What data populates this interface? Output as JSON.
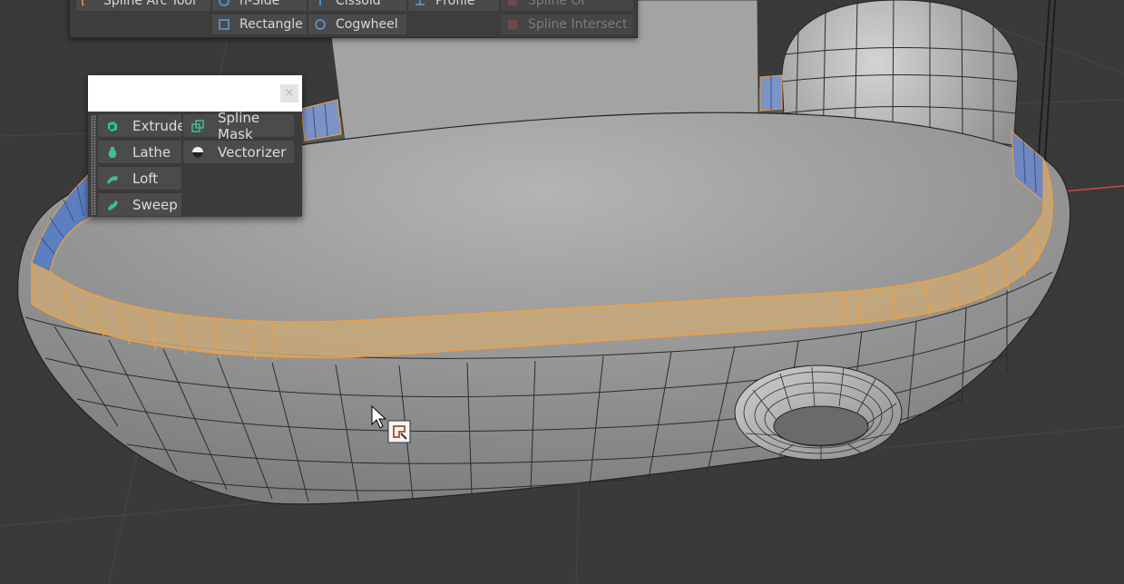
{
  "colors": {
    "background": "#3a3a3a",
    "selection_edge": "#f0a040",
    "selection_fill": "#c9a878",
    "menu_bg": "#3d3d3d",
    "item_bg": "#4a4a4a",
    "generator_icon": "#3fbf8f",
    "spline_icon": "#5a9bd8",
    "axis_red": "#c84b4b"
  },
  "top_menu": {
    "items": [
      {
        "label": "Spline Arc Tool",
        "icon": "arc-spline-icon",
        "disabled": false
      },
      {
        "label": "n-Side",
        "icon": "nside-icon",
        "disabled": false
      },
      {
        "label": "Cissoid",
        "icon": "cissoid-icon",
        "disabled": false
      },
      {
        "label": "Profile",
        "icon": "profile-icon",
        "disabled": false
      },
      {
        "label": "Spline Or",
        "icon": "spline-or-icon",
        "disabled": true
      },
      {
        "label": "Rectangle",
        "icon": "rectangle-icon",
        "disabled": false
      },
      {
        "label": "Cogwheel",
        "icon": "cogwheel-icon",
        "disabled": false
      },
      {
        "label": "Spline Intersect",
        "icon": "spline-intersect-icon",
        "disabled": true
      }
    ]
  },
  "generators_panel": {
    "title": "",
    "close_symbol": "×",
    "items": [
      {
        "label": "Extrude",
        "icon": "extrude-icon"
      },
      {
        "label": "Spline Mask",
        "icon": "spline-mask-icon"
      },
      {
        "label": "Lathe",
        "icon": "lathe-icon"
      },
      {
        "label": "Vectorizer",
        "icon": "vectorizer-icon"
      },
      {
        "label": "Loft",
        "icon": "loft-icon"
      },
      {
        "label": "Sweep",
        "icon": "sweep-icon"
      }
    ]
  },
  "viewport": {
    "objects": [
      "boat-hull",
      "hull-rim-selection",
      "cabin-wall",
      "dome-cabin",
      "torus-ring",
      "antenna-mast"
    ]
  }
}
